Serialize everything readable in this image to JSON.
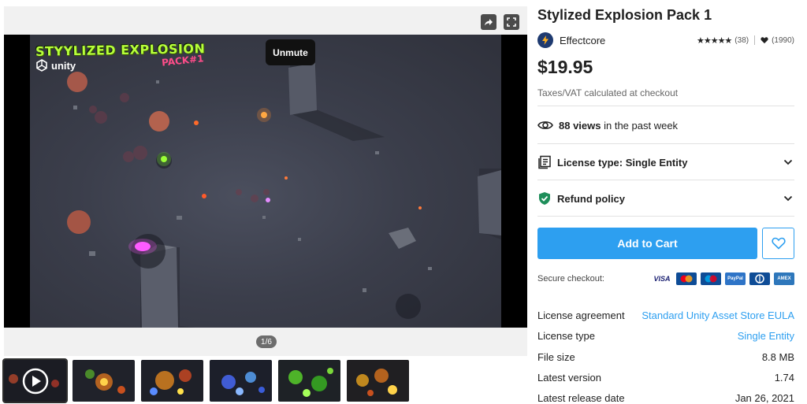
{
  "media": {
    "unmute_label": "Unmute",
    "logo_title": "STYYLIZED EXPLOSION",
    "logo_pack": "PACK#1",
    "logo_unity": "unity",
    "slide_counter": "1/6",
    "thumbnail_count": 6
  },
  "product": {
    "title": "Stylized Explosion Pack 1",
    "publisher": "Effectcore",
    "rating_stars": 5,
    "rating_count": "(38)",
    "favorites_count": "(1990)",
    "price": "$19.95",
    "tax_note": "Taxes/VAT calculated at checkout",
    "views_count": "88 views",
    "views_suffix": " in the past week",
    "license_row_label": "License type: Single Entity",
    "refund_label": "Refund policy",
    "add_to_cart": "Add to Cart",
    "secure_checkout": "Secure checkout:",
    "payment_methods": [
      "VISA",
      "MC",
      "Maestro",
      "PayPal",
      "Diners",
      "AMEX"
    ]
  },
  "details": [
    {
      "key": "License agreement",
      "value": "Standard Unity Asset Store EULA",
      "link": true
    },
    {
      "key": "License type",
      "value": "Single Entity",
      "link": true
    },
    {
      "key": "File size",
      "value": "8.8 MB",
      "link": false
    },
    {
      "key": "Latest version",
      "value": "1.74",
      "link": false
    },
    {
      "key": "Latest release date",
      "value": "Jan 26, 2021",
      "link": false
    }
  ],
  "colors": {
    "accent": "#2d9ff0",
    "text": "#212121",
    "refund_shield": "#1e8e5a"
  }
}
